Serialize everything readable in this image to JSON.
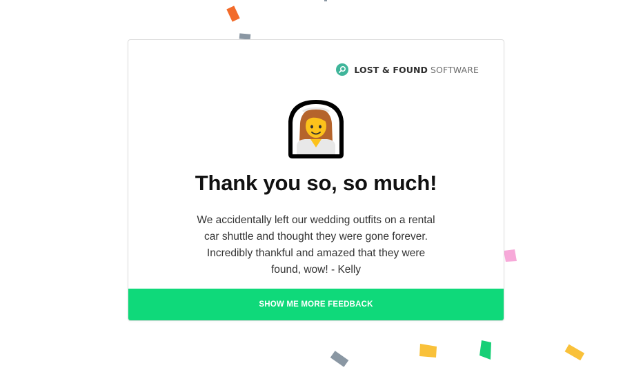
{
  "card": {
    "brand": {
      "bold": "LOST & FOUND",
      "light": "SOFTWARE",
      "icon": "magnifier-logo-icon",
      "accent": "#3fb59a"
    },
    "emoji": {
      "icon": "bride-with-veil-emoji-icon"
    },
    "headline": "Thank you so, so much!",
    "quote": "We accidentally left our wedding outfits on a rental car shuttle and thought they were gone forever. Incredibly thankful and amazed that they were found, wow! - Kelly",
    "cta_label": "SHOW ME MORE FEEDBACK",
    "cta_color": "#0fd97a"
  },
  "confetti_colors": [
    "#f26b2a",
    "#8a97a3",
    "#f7a9d9",
    "#f9c13a",
    "#17cf76"
  ]
}
